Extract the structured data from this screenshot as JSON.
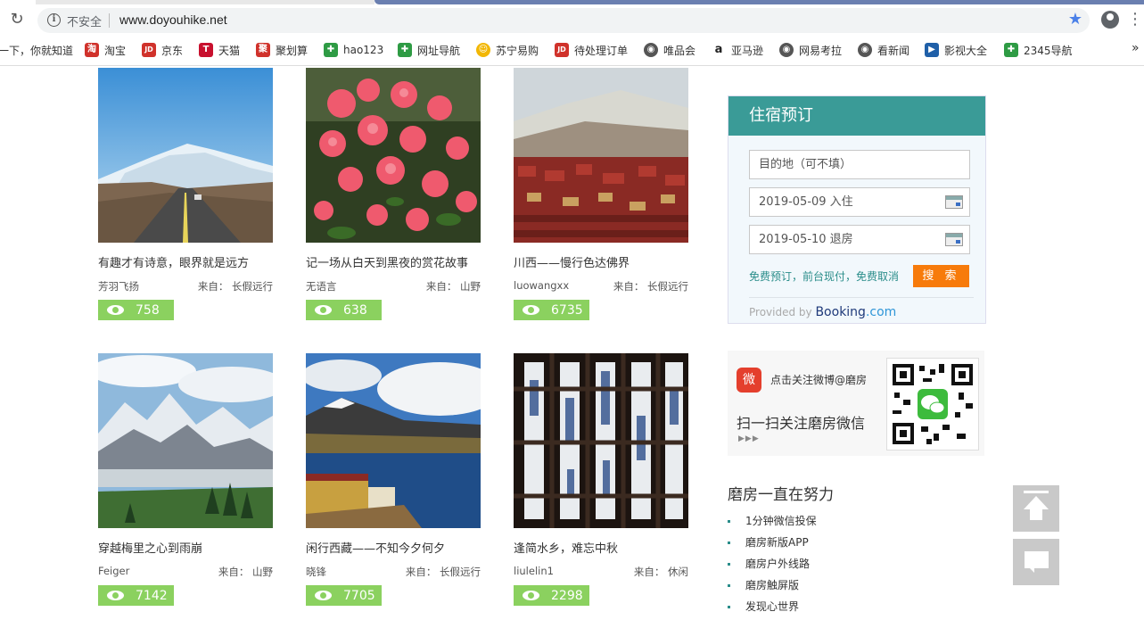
{
  "browser": {
    "insecure_label": "不安全",
    "url": "www.doyouhike.net",
    "bookmarks": [
      {
        "label": "一下，你就知道",
        "icon": "baidu-icon"
      },
      {
        "label": "淘宝",
        "icon": "taobao-icon",
        "glyph": "淘",
        "color": "#d0322b"
      },
      {
        "label": "京东",
        "icon": "jd-icon",
        "glyph": "JD",
        "color": "#d0322b"
      },
      {
        "label": "天猫",
        "icon": "tmall-icon",
        "glyph": "T",
        "color": "#c8102e"
      },
      {
        "label": "聚划算",
        "icon": "juhuasuan-icon",
        "glyph": "聚",
        "color": "#d0322b"
      },
      {
        "label": "hao123",
        "icon": "hao123-icon",
        "glyph": "✚",
        "color": "#2e9b44"
      },
      {
        "label": "网址导航",
        "icon": "nav-icon",
        "glyph": "✚",
        "color": "#2e9b44"
      },
      {
        "label": "苏宁易购",
        "icon": "suning-icon",
        "glyph": "☺",
        "color": "#f2b705"
      },
      {
        "label": "待处理订单",
        "icon": "jd-icon",
        "glyph": "JD",
        "color": "#d0322b"
      },
      {
        "label": "唯品会",
        "icon": "globe-icon",
        "glyph": "◉",
        "color": "#555555"
      },
      {
        "label": "亚马逊",
        "icon": "amazon-icon",
        "glyph": "a",
        "color": "#222222"
      },
      {
        "label": "网易考拉",
        "icon": "globe-icon",
        "glyph": "◉",
        "color": "#555555"
      },
      {
        "label": "看新闻",
        "icon": "globe-icon",
        "glyph": "◉",
        "color": "#555555"
      },
      {
        "label": "影视大全",
        "icon": "video-icon",
        "glyph": "▶",
        "color": "#1f5fa8"
      },
      {
        "label": "2345导航",
        "icon": "nav2345-icon",
        "glyph": "✚",
        "color": "#2e9b44"
      }
    ]
  },
  "posts": [
    {
      "title": "有趣才有诗意，眼界就是远方",
      "author": "芳羽飞扬",
      "from": "来自： 长假远行",
      "views": "758"
    },
    {
      "title": "记一场从白天到黑夜的赏花故事",
      "author": "无语言",
      "from": "来自： 山野",
      "views": "638"
    },
    {
      "title": "川西——慢行色达佛界",
      "author": "luowangxx",
      "from": "来自： 长假远行",
      "views": "6735"
    },
    {
      "title": "穿越梅里之心到雨崩",
      "author": "Feiger",
      "from": "来自： 山野",
      "views": "7142"
    },
    {
      "title": "闲行西藏——不知今夕何夕",
      "author": "晓锋",
      "from": "来自： 长假远行",
      "views": "7705"
    },
    {
      "title": "逢简水乡，难忘中秋",
      "author": "liulelin1",
      "from": "来自： 休闲",
      "views": "2298"
    }
  ],
  "booking": {
    "title": "住宿预订",
    "destination_placeholder": "目的地（可不填）",
    "checkin": "2019-05-09 入住",
    "checkout": "2019-05-10 退房",
    "free_text": "免费预订，前台现付，免费取消",
    "search_label": "搜 索",
    "provided_by": "Provided by",
    "brand_a": "Booking",
    "brand_b": ".com"
  },
  "social": {
    "weibo_follow": "点击关注微博@磨房",
    "wechat_scan": "扫一扫关注磨房微信",
    "arrows": "▶▶▶"
  },
  "effort": {
    "title": "磨房一直在努力",
    "items": [
      "1分钟微信投保",
      "磨房新版APP",
      "磨房户外线路",
      "磨房触屏版",
      "发现心世界"
    ]
  }
}
